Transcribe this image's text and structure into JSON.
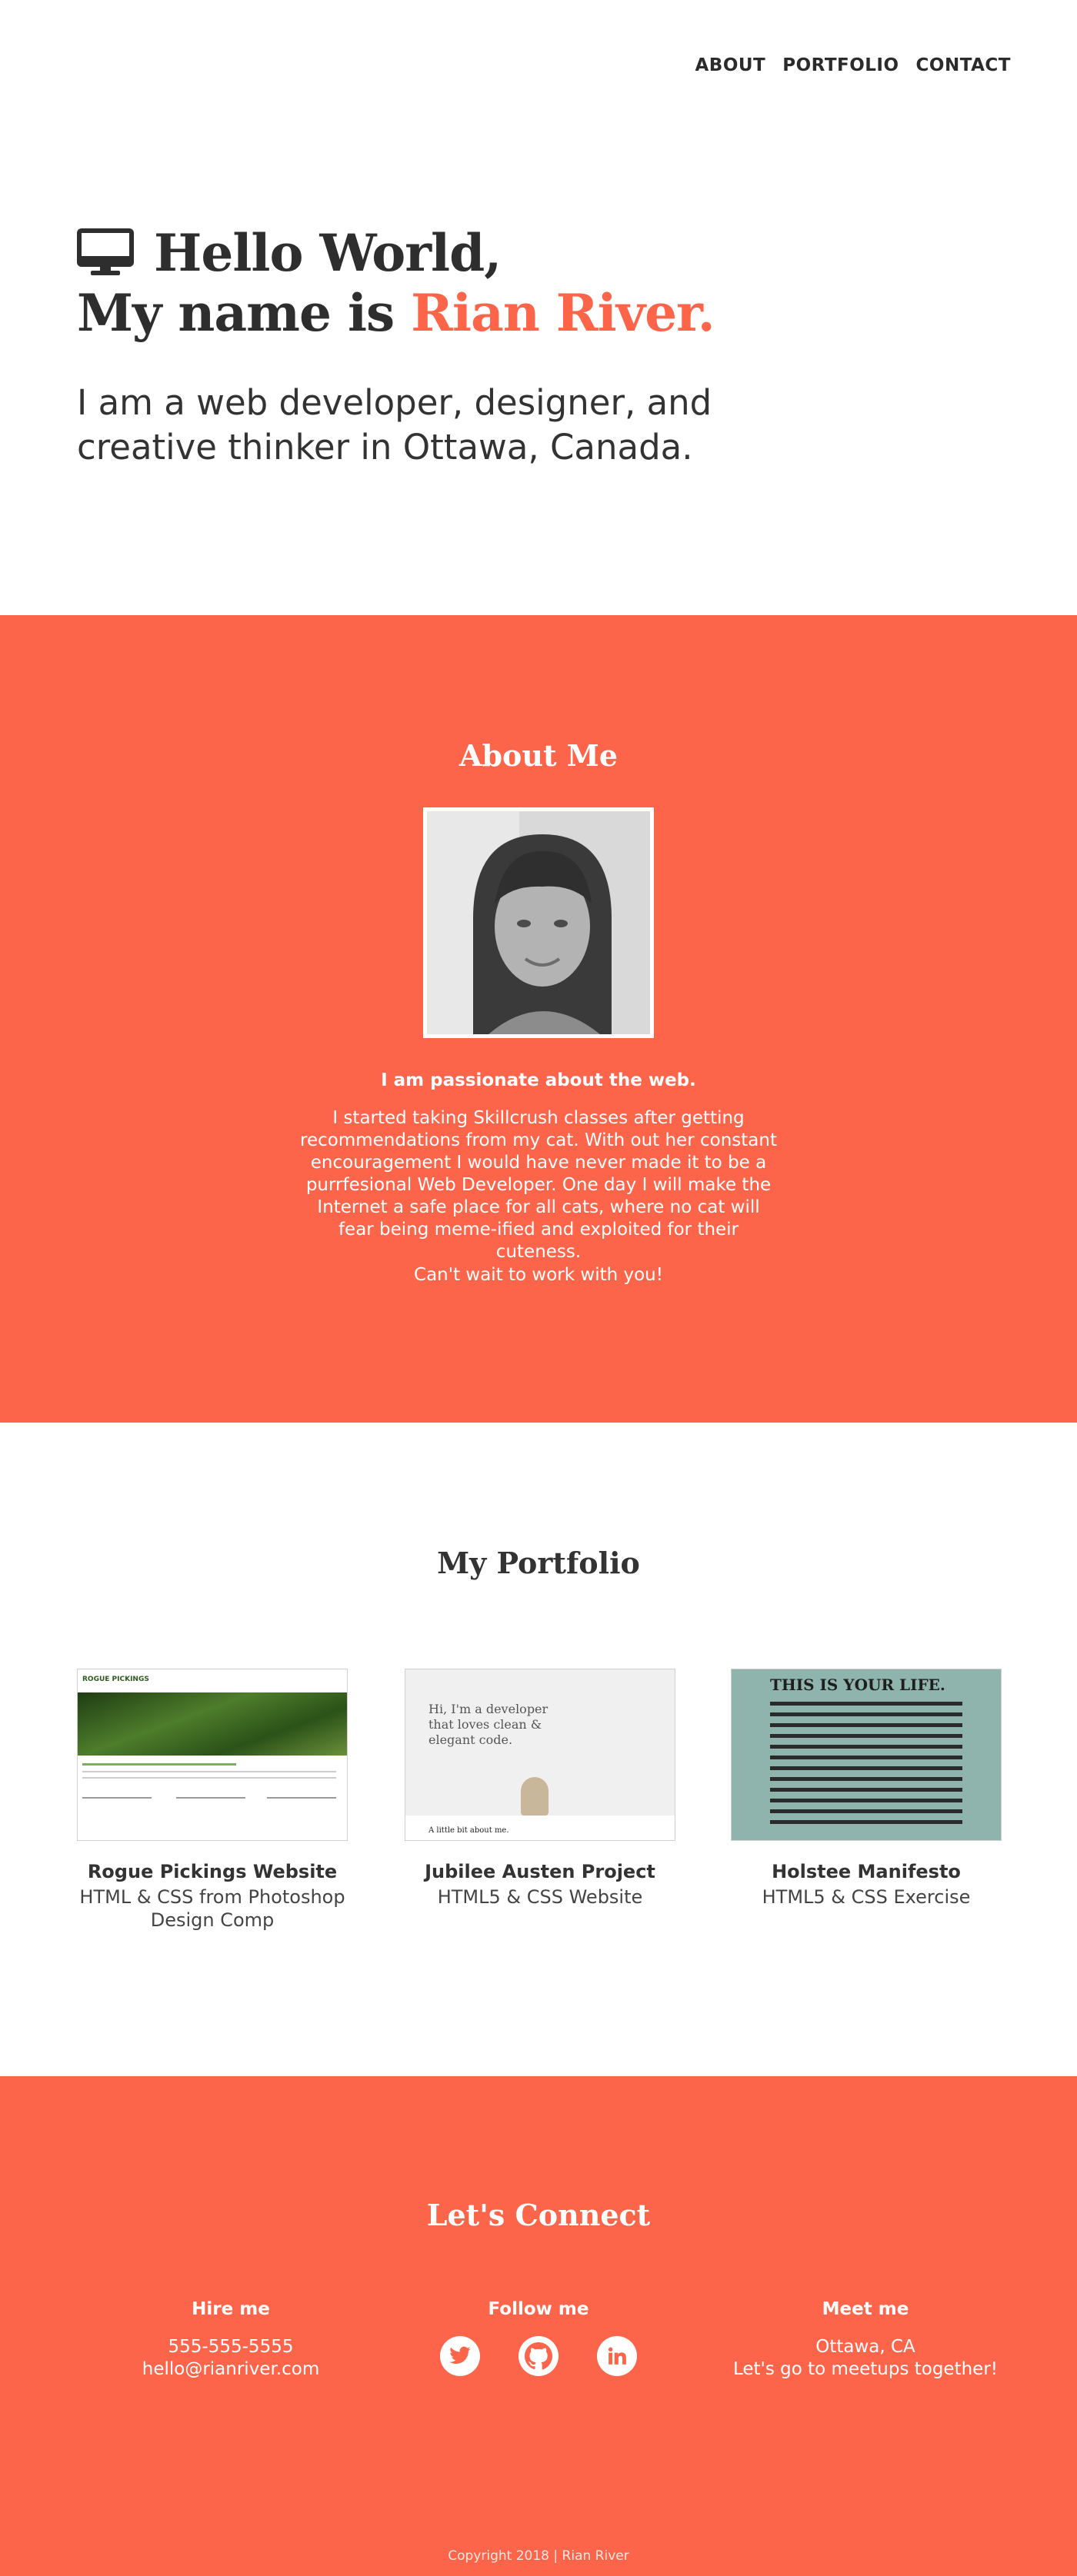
{
  "nav": {
    "items": [
      "ABOUT",
      "PORTFOLIO",
      "CONTACT"
    ]
  },
  "hero": {
    "greeting": "Hello World,",
    "name_prefix": "My name is ",
    "name": "Rian River.",
    "subtitle": "I am a web developer, designer, and creative thinker in Ottawa, Canada."
  },
  "about": {
    "title": "About Me",
    "lead": "I am passionate about the web.",
    "body": "I started taking Skillcrush classes after getting recommendations from my cat. With out her constant encouragement I would have never made it to be a purrfesional Web Developer. One day I will make the Internet a safe place for all cats, where no cat will fear being meme-ified and exploited for their cuteness.",
    "cta": "Can't wait to work with you!"
  },
  "portfolio": {
    "title": "My Portfolio",
    "projects": [
      {
        "title": "Rogue Pickings Website",
        "desc": "HTML & CSS from Photoshop Design Comp",
        "thumb_text": "ROGUE PICKINGS"
      },
      {
        "title": "Jubilee Austen Project",
        "desc": "HTML5 & CSS Website",
        "thumb_text": "Hi, I'm a developer that loves clean & elegant code.",
        "thumb_foot": "A little bit about me."
      },
      {
        "title": "Holstee Manifesto",
        "desc": "HTML5 & CSS Exercise",
        "thumb_text": "THIS IS YOUR LIFE."
      }
    ]
  },
  "connect": {
    "title": "Let's Connect",
    "hire": {
      "heading": "Hire me",
      "phone": "555-555-5555",
      "email": "hello@rianriver.com"
    },
    "follow": {
      "heading": "Follow me",
      "icons": [
        "twitter-icon",
        "github-icon",
        "linkedin-icon"
      ]
    },
    "meet": {
      "heading": "Meet me",
      "location": "Ottawa, CA",
      "note": "Let's go to meetups together!"
    },
    "copyright": "Copyright 2018  |  Rian River"
  },
  "colors": {
    "accent": "#fd654b",
    "text": "#333333",
    "white": "#ffffff"
  }
}
